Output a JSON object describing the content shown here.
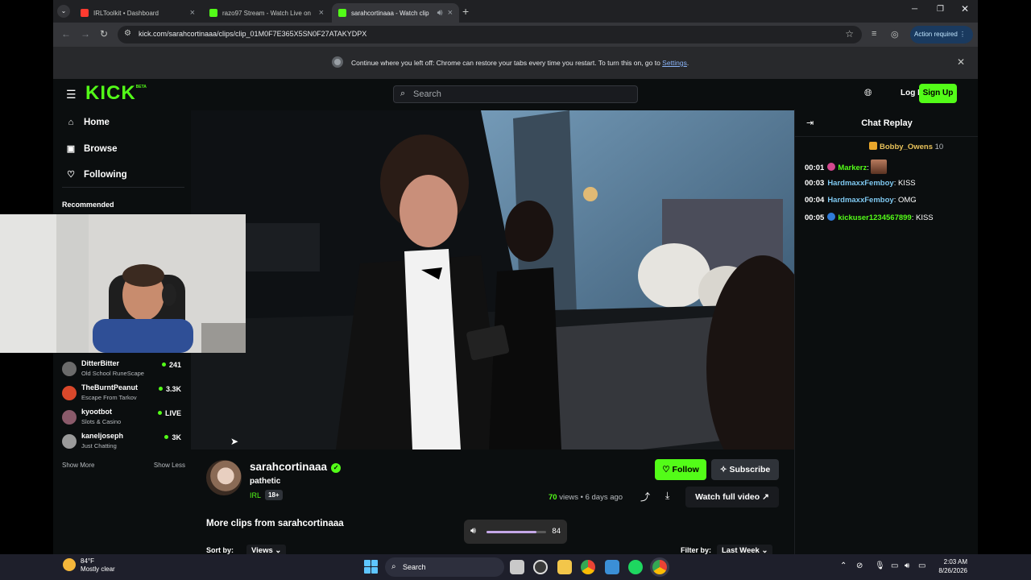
{
  "browser": {
    "tabs": [
      {
        "title": "IRLToolkit • Dashboard",
        "color": "#ff3b30"
      },
      {
        "title": "razo97 Stream - Watch Live on",
        "color": "#53fc18"
      },
      {
        "title": "sarahcortinaaa - Watch clip",
        "color": "#53fc18"
      }
    ],
    "url": "kick.com/sarahcortinaaa/clips/clip_01M0F7E365X5SN0F27ATAKYDPX",
    "action_required": "Action required",
    "infobar": {
      "message": "Continue where you left off: Chrome can restore your tabs every time you restart. To turn this on, go to",
      "link": "Settings",
      "suffix": "."
    }
  },
  "kick": {
    "logo": "KICK",
    "logo_badge": "BETA",
    "search_placeholder": "Search",
    "login": "Log In",
    "signup": "Sign Up",
    "nav": {
      "home": "Home",
      "browse": "Browse",
      "following": "Following"
    },
    "recommended_label": "Recommended",
    "channels": [
      {
        "name": "DitterBitter",
        "category": "Old School RuneScape",
        "viewers": "241",
        "avatar": "#6b6b6b"
      },
      {
        "name": "TheBurntPeanut",
        "category": "Escape From Tarkov",
        "viewers": "3.3K",
        "avatar": "#d9482b"
      },
      {
        "name": "kyootbot",
        "category": "Slots & Casino",
        "viewers": "LIVE",
        "avatar": "#8a5a6a"
      },
      {
        "name": "kaneljoseph",
        "category": "Just Chatting",
        "viewers": "3K",
        "avatar": "#9a9a9a"
      }
    ],
    "show_more": "Show More",
    "show_less": "Show Less",
    "clip": {
      "channel": "sarahcortinaaa",
      "title": "pathetic",
      "category": "IRL",
      "rating": "18+",
      "views": "70",
      "views_suffix": " views",
      "age": " • 6 days ago",
      "follow": "Follow",
      "subscribe": "Subscribe",
      "watch_full": "Watch full video"
    },
    "more_clips": "More clips from sarahcortinaaa",
    "sort_by": "Sort by:",
    "sort_value": "Views",
    "filter_by": "Filter by:",
    "filter_value": "Last Week"
  },
  "chat": {
    "title": "Chat Replay",
    "pinned_user": "Bobby_Owens",
    "pinned_count": "10",
    "messages": [
      {
        "time": "00:01",
        "user": "Markerz",
        "text": "",
        "color": "#53fc18",
        "badge": "#d4498f",
        "emote": true
      },
      {
        "time": "00:03",
        "user": "HardmaxxFemboy",
        "text": ": KISS",
        "color": "#7ec8f0",
        "badge": "",
        "emote": false
      },
      {
        "time": "00:04",
        "user": "HardmaxxFemboy",
        "text": ": OMG",
        "color": "#7ec8f0",
        "badge": "",
        "emote": false
      },
      {
        "time": "00:05",
        "user": "kickuser1234567899",
        "text": ": KISS",
        "color": "#53fc18",
        "badge": "#2f7bd8",
        "emote": false
      }
    ]
  },
  "volume": {
    "level": 84,
    "label": "84"
  },
  "taskbar": {
    "temp": "84°F",
    "condition": "Mostly clear",
    "search": "Search",
    "time": "2:03 AM",
    "date": "8/26/2026"
  }
}
